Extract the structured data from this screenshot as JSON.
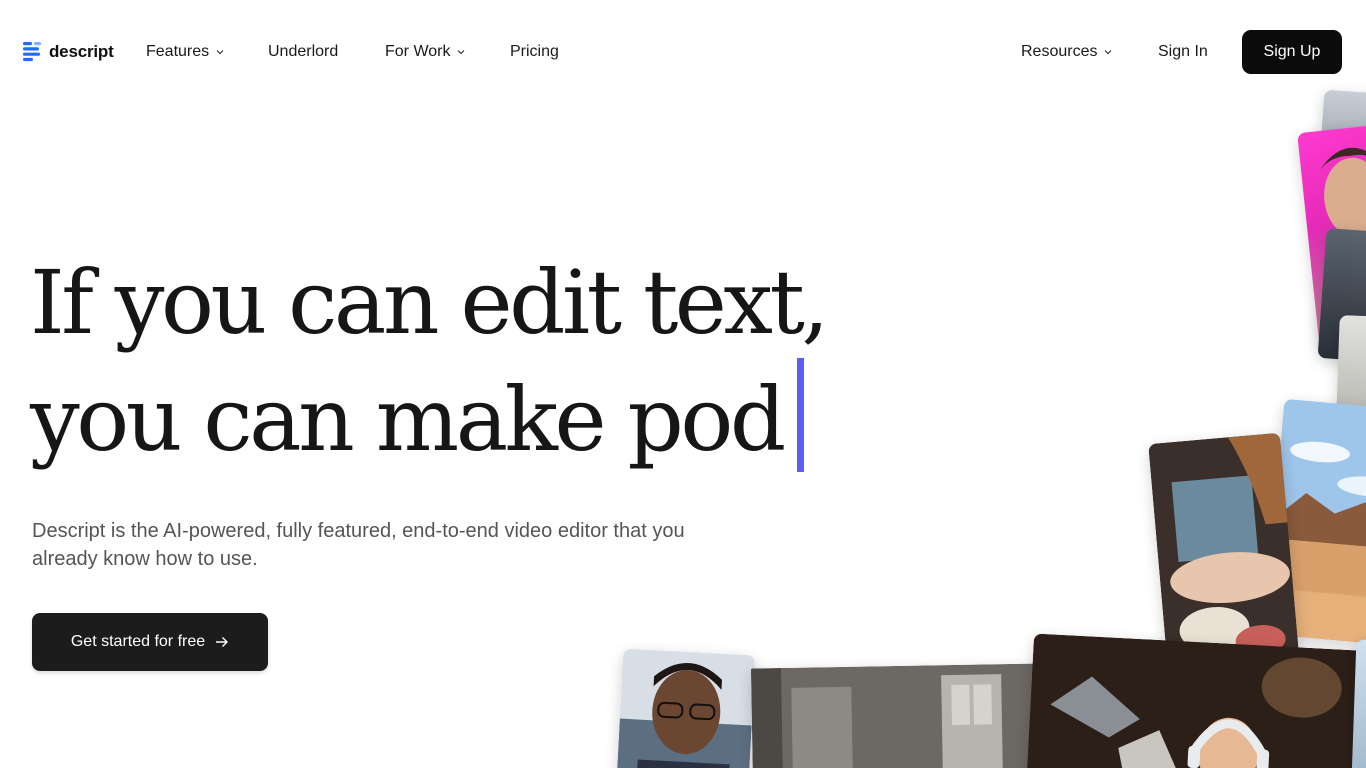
{
  "brand": {
    "name": "descript",
    "accent": "#1f6bff"
  },
  "nav": {
    "left": [
      {
        "label": "Features",
        "dropdown": true
      },
      {
        "label": "Underlord",
        "dropdown": false
      },
      {
        "label": "For Work",
        "dropdown": true
      },
      {
        "label": "Pricing",
        "dropdown": false
      }
    ],
    "resources": "Resources",
    "sign_in": "Sign In",
    "sign_up": "Sign Up"
  },
  "hero": {
    "line1": "If you can edit text,",
    "line2": "you can make pod",
    "caret_color": "#5b5ef3",
    "description": "Descript is the AI-powered, fully featured, end-to-end video editor that you already know how to use.",
    "cta_label": "Get started for free",
    "cta_icon": "arrow-right-icon"
  },
  "collage": {
    "items": [
      "man-portrait-pink-background",
      "woman-portrait-strip",
      "cooking-hands-kitchen",
      "desert-landscape",
      "man-with-glasses-webcam",
      "living-room-window",
      "woman-with-headphones-lamp"
    ]
  }
}
